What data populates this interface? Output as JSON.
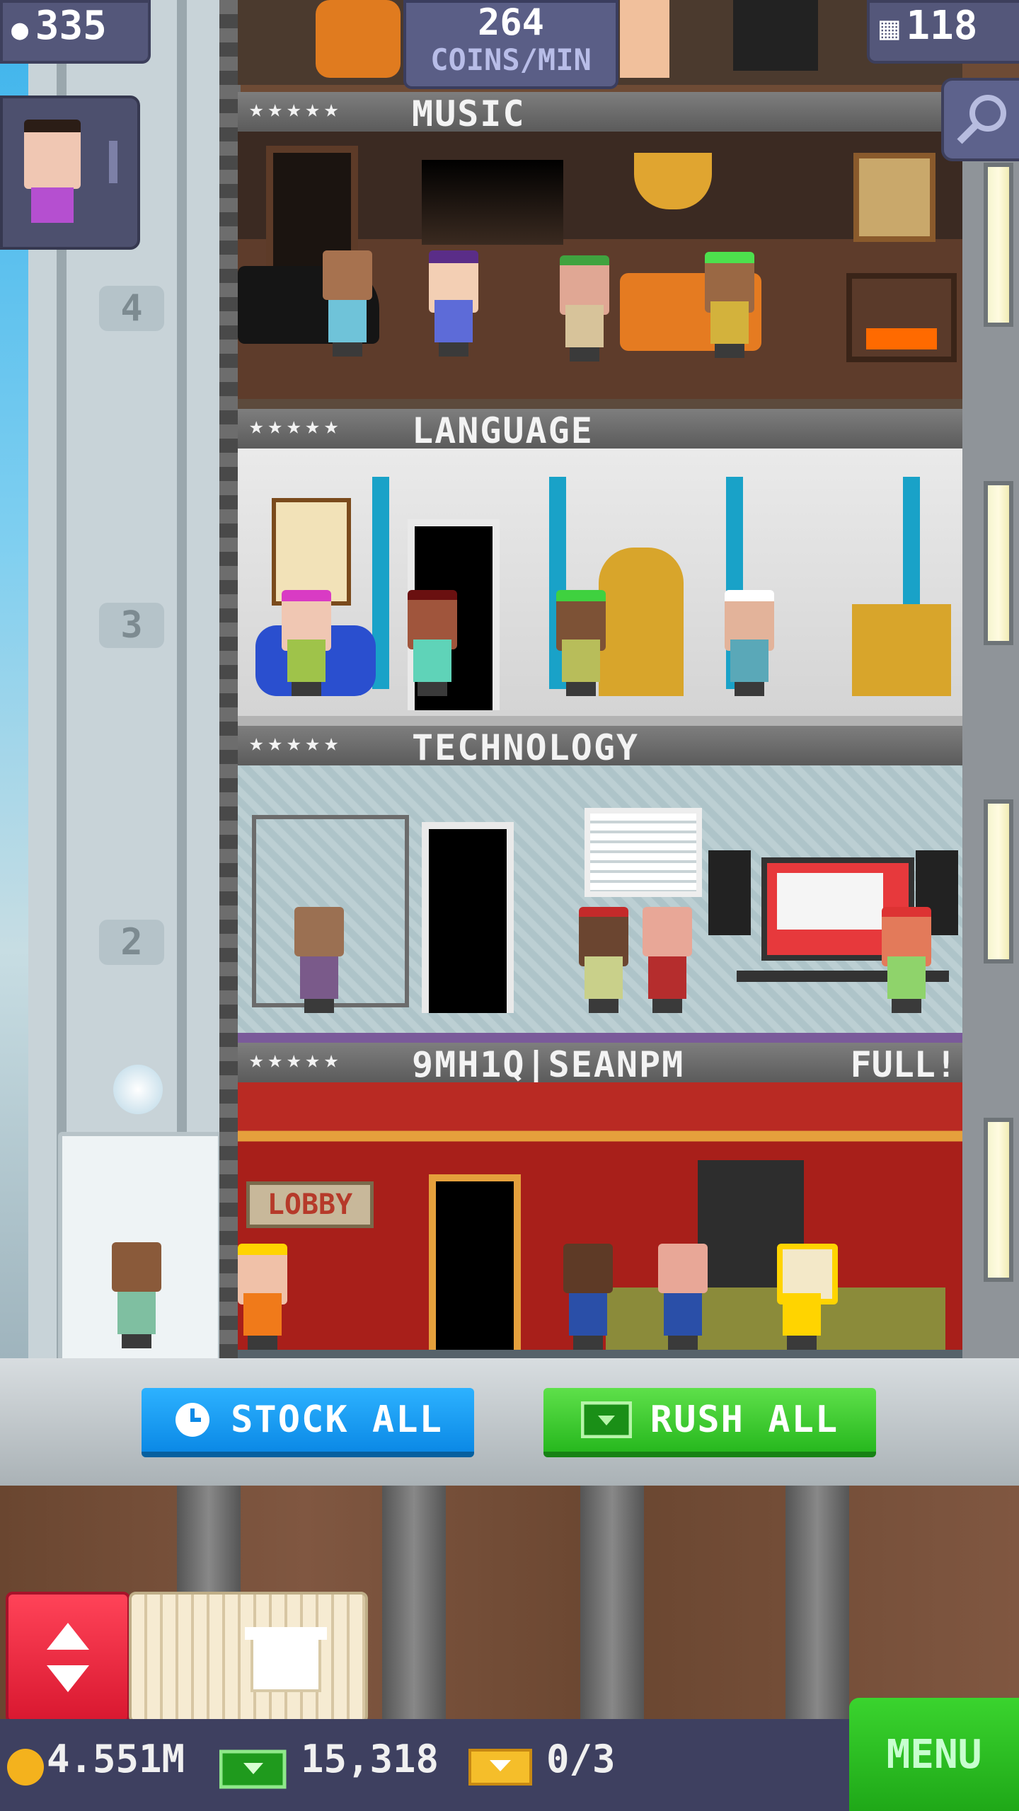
{
  "hud": {
    "population": "335",
    "income_value": "264",
    "income_unit": "COINS/MIN",
    "floor_count": "118"
  },
  "floors": [
    {
      "stars": "★★★★★",
      "name": "MUSIC",
      "status": ""
    },
    {
      "stars": "★★★★★",
      "name": "LANGUAGE",
      "status": ""
    },
    {
      "stars": "★★★★★",
      "name": "TECHNOLOGY",
      "status": ""
    },
    {
      "stars": "★★★★★",
      "name": "9MH1Q|SEANPM",
      "status": "FULL!"
    }
  ],
  "elevator": {
    "floor_marks": [
      "4",
      "3",
      "2"
    ]
  },
  "lobby_sign": "LOBBY",
  "actions": {
    "stock_all": "STOCK ALL",
    "rush_all": "RUSH ALL"
  },
  "resources": {
    "coins": "4.551M",
    "bux": "15,318",
    "tickets": "0/3"
  },
  "menu_label": "MENU",
  "colors": {
    "stock_blue": "#0b89e6",
    "rush_green": "#27b81e",
    "elevator_red": "#d91830",
    "hud_bg": "#54577a"
  },
  "icons": [
    "person-icon",
    "floors-icon",
    "magnifier-icon",
    "clock-icon",
    "bux-icon",
    "up-down-arrows-icon",
    "crate-icon",
    "coin-icon",
    "ticket-icon"
  ]
}
